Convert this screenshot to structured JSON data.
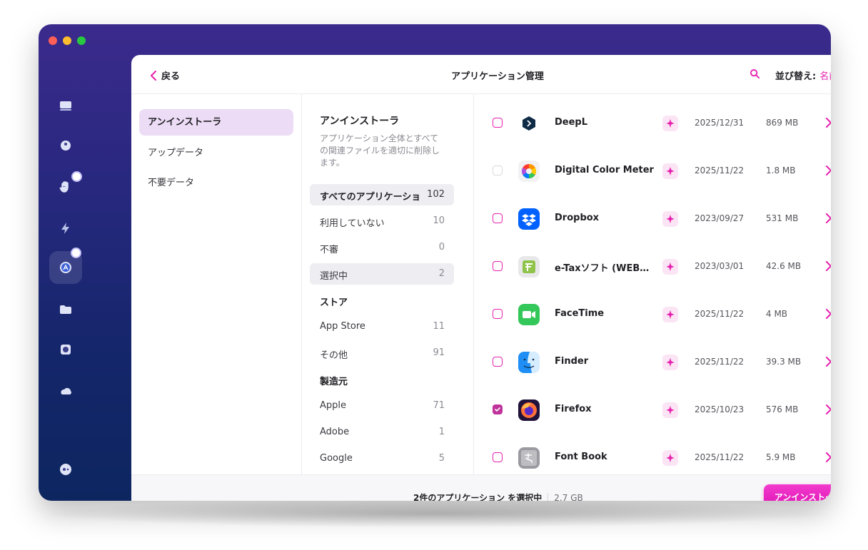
{
  "window": {
    "title": "アプリケーション管理"
  },
  "header": {
    "back_label": "戻る",
    "sort_label": "並び替え:",
    "sort_value": "名前"
  },
  "sidebar": {
    "items": [
      {
        "label": "アンインストーラ"
      },
      {
        "label": "アップデータ"
      },
      {
        "label": "不要データ"
      }
    ]
  },
  "panel": {
    "title": "アンインストーラ",
    "description": "アプリケーション全体とすべての関連ファイルを適切に削除します。",
    "groups": [
      {
        "label": "すべてのアプリケーショ",
        "count": "102"
      },
      {
        "label": "利用していない",
        "count": "10"
      },
      {
        "label": "不審",
        "count": "0"
      },
      {
        "label": "選択中",
        "count": "2"
      }
    ],
    "store_heading": "ストア",
    "stores": [
      {
        "label": "App Store",
        "count": "11"
      },
      {
        "label": "その他",
        "count": "91"
      }
    ],
    "vendor_heading": "製造元",
    "vendors": [
      {
        "label": "Apple",
        "count": "71"
      },
      {
        "label": "Adobe",
        "count": "1"
      },
      {
        "label": "Google",
        "count": "5"
      }
    ]
  },
  "apps": [
    {
      "name": "DeepL",
      "date": "2025/12/31",
      "size": "869 MB",
      "checked": false,
      "icon": "deepl-icon"
    },
    {
      "name": "Digital Color Meter",
      "date": "2025/11/22",
      "size": "1.8 MB",
      "checked": false,
      "icon": "digital-color-meter-icon"
    },
    {
      "name": "Dropbox",
      "date": "2023/09/27",
      "size": "531 MB",
      "checked": false,
      "icon": "dropbox-icon"
    },
    {
      "name": "e-Taxソフト (WEB…",
      "date": "2023/03/01",
      "size": "42.6 MB",
      "checked": false,
      "icon": "etax-icon"
    },
    {
      "name": "FaceTime",
      "date": "2025/11/22",
      "size": "4 MB",
      "checked": false,
      "icon": "facetime-icon"
    },
    {
      "name": "Finder",
      "date": "2025/11/22",
      "size": "39.3 MB",
      "checked": false,
      "icon": "finder-icon"
    },
    {
      "name": "Firefox",
      "date": "2025/10/23",
      "size": "576 MB",
      "checked": true,
      "icon": "firefox-icon"
    },
    {
      "name": "Font Book",
      "date": "2025/11/22",
      "size": "5.9 MB",
      "checked": false,
      "icon": "font-book-icon"
    }
  ],
  "footer": {
    "selection_text": "2件のアプリケーション を選択中",
    "selection_size": "2.7 GB",
    "uninstall_label": "アンインストール"
  },
  "colors": {
    "accent": "#e61fad",
    "sidebar_active": "#ecdcf5",
    "window_bg": "#27287e"
  }
}
